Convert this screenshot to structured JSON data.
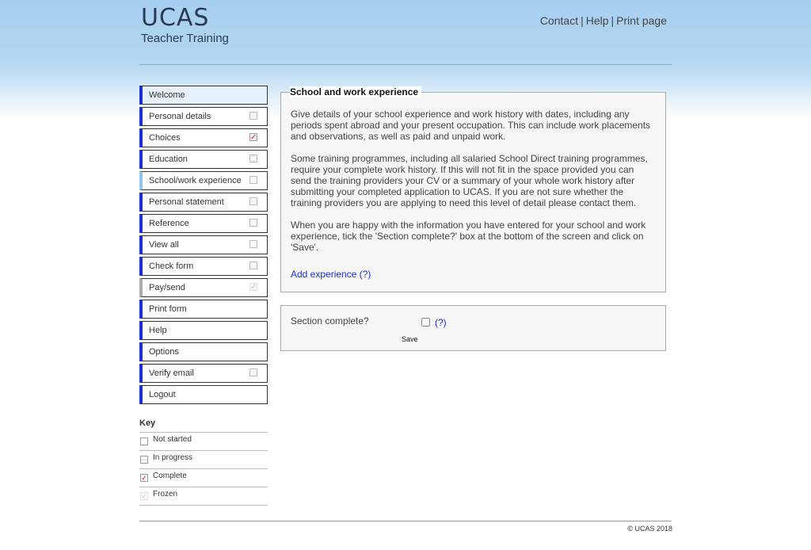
{
  "header": {
    "logo_main": "UCAS",
    "logo_sub": "Teacher Training",
    "links": [
      "Contact",
      "Help",
      "Print page"
    ],
    "separator": "|"
  },
  "nav": {
    "items": [
      {
        "label": "Welcome",
        "status": "none"
      },
      {
        "label": "Personal details",
        "status": "not-started"
      },
      {
        "label": "Choices",
        "status": "complete"
      },
      {
        "label": "Education",
        "status": "not-started"
      },
      {
        "label": "School/work experience",
        "status": "not-started"
      },
      {
        "label": "Personal statement",
        "status": "not-started"
      },
      {
        "label": "Reference",
        "status": "not-started"
      },
      {
        "label": "View all",
        "status": "not-started"
      },
      {
        "label": "Check form",
        "status": "not-started"
      },
      {
        "label": "Pay/send",
        "status": "frozen"
      },
      {
        "label": "Print form",
        "status": "none"
      },
      {
        "label": "Help",
        "status": "none"
      },
      {
        "label": "Options",
        "status": "none"
      },
      {
        "label": "Verify email",
        "status": "not-started"
      },
      {
        "label": "Logout",
        "status": "none"
      }
    ]
  },
  "key": {
    "title": "Key",
    "items": [
      {
        "label": "Not started",
        "status": "not-started"
      },
      {
        "label": "In progress",
        "status": "in-progress"
      },
      {
        "label": "Complete",
        "status": "complete"
      },
      {
        "label": "Frozen",
        "status": "frozen"
      }
    ]
  },
  "main": {
    "title": "School and work experience",
    "paragraphs": [
      "Give details of your school experience and work history with dates, including any periods spent abroad and your present occupation. This can include work placements and observations, as well as paid and unpaid work.",
      "Some training programmes, including all salaried School Direct training programmes, require your complete work history. If this will not fit in the space provided you can send the training providers your CV or a summary of your whole work history after submitting your completed application to UCAS. If you are not sure whether the training providers you are applying to need this level of detail please contact them.",
      "When you are happy with the information you have entered for your school and work experience, tick the 'Section complete?' box at the bottom of the screen and click on 'Save'."
    ],
    "add_link": "Add experience (?)"
  },
  "section_complete": {
    "label": "Section complete?",
    "help": "(?)",
    "save_label": "Save"
  },
  "footer": {
    "copyright": "© UCAS 2018"
  },
  "colors": {
    "nav_accent": "#1b2fd6",
    "link": "#2030c8",
    "complete_tick": "#d01a1a"
  }
}
